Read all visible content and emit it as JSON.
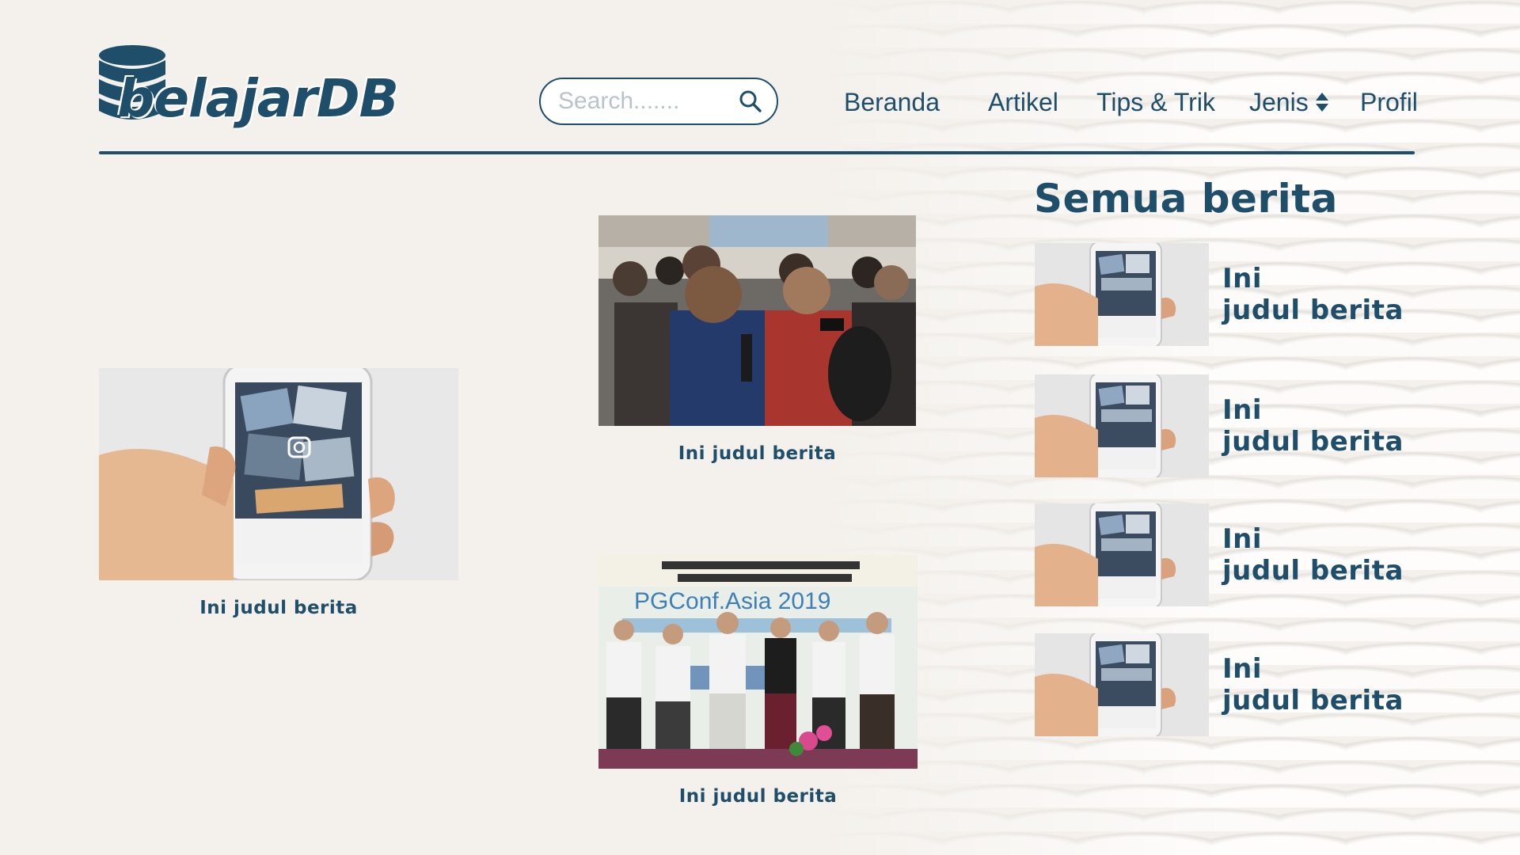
{
  "brand": {
    "name": "belajarDB",
    "primary_color": "#1f4e6b"
  },
  "search": {
    "placeholder": "Search.......",
    "value": ""
  },
  "nav": {
    "items": [
      {
        "label": "Beranda"
      },
      {
        "label": "Artikel"
      },
      {
        "label": "Tips & Trik"
      },
      {
        "label": "Jenis",
        "icon": "sort-updown-icon"
      },
      {
        "label": "Profil"
      }
    ]
  },
  "featured": [
    {
      "caption": "Ini judul berita",
      "image": "hand-holding-phone-instagram"
    },
    {
      "caption": "Ini judul berita",
      "image": "press-crowd-interview"
    },
    {
      "caption": "Ini judul berita",
      "image": "pgconf-asia-2019-group-photo"
    }
  ],
  "all_news": {
    "title": "Semua berita",
    "items": [
      {
        "title_line1": "Ini",
        "title_line2": "judul berita",
        "image": "hand-holding-phone-instagram"
      },
      {
        "title_line1": "Ini",
        "title_line2": "judul berita",
        "image": "hand-holding-phone-instagram"
      },
      {
        "title_line1": "Ini",
        "title_line2": "judul berita",
        "image": "hand-holding-phone-instagram"
      },
      {
        "title_line1": "Ini",
        "title_line2": "judul berita",
        "image": "hand-holding-phone-instagram"
      }
    ]
  },
  "pgconf_banner_text": "PGConf.Asia 2019"
}
